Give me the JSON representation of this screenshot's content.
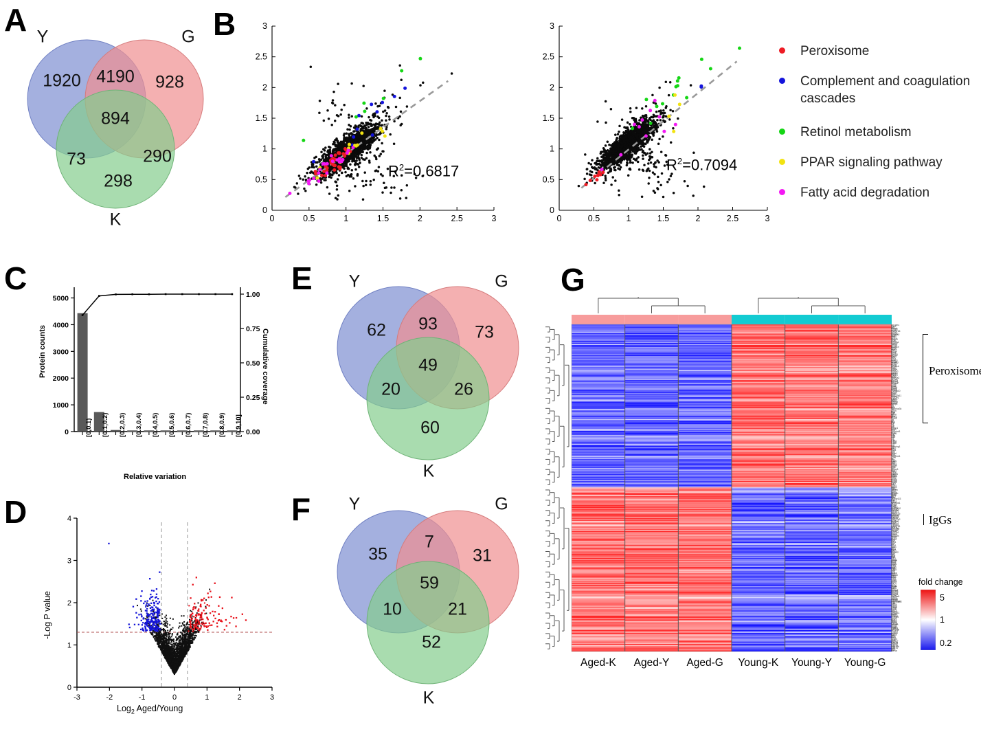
{
  "figure": {
    "panels": [
      "A",
      "B",
      "C",
      "D",
      "E",
      "F",
      "G"
    ]
  },
  "panelA": {
    "letter": "A",
    "labels": {
      "y": "Y",
      "g": "G",
      "k": "K"
    },
    "counts": {
      "y_only": "1920",
      "g_only": "928",
      "k_only": "298",
      "yg": "4190",
      "yk": "73",
      "gk": "290",
      "ygk": "894"
    },
    "colors": {
      "y": "#8b9ad6",
      "g": "#ef8f90",
      "k": "#85cd8d"
    }
  },
  "panelB": {
    "letter": "B",
    "scatter_left": {
      "r2_label": "R",
      "r2_exp": "2",
      "r2_value": "=0.6817",
      "xticks": [
        "0",
        "0.5",
        "1",
        "1.5",
        "2",
        "2.5",
        "3"
      ],
      "yticks": [
        "0",
        "0.5",
        "1",
        "1.5",
        "2",
        "2.5",
        "3"
      ],
      "xlim": [
        0,
        3
      ],
      "ylim": [
        0,
        3
      ]
    },
    "scatter_right": {
      "r2_label": "R",
      "r2_exp": "2",
      "r2_value": "=0.7094",
      "xticks": [
        "0",
        "0.5",
        "1",
        "1.5",
        "2",
        "2.5",
        "3"
      ],
      "yticks": [
        "0",
        "0.5",
        "1",
        "1.5",
        "2",
        "2.5",
        "3"
      ],
      "xlim": [
        0,
        3
      ],
      "ylim": [
        0,
        3
      ]
    },
    "legend": [
      {
        "label": "Peroxisome",
        "color": "#ee1c25"
      },
      {
        "label": "Complement and coagulation cascades",
        "color": "#1414dc"
      },
      {
        "label": "Retinol metabolism",
        "color": "#15d615"
      },
      {
        "label": "PPAR signaling pathway",
        "color": "#f2e311"
      },
      {
        "label": "Fatty acid degradation",
        "color": "#f318f3"
      }
    ]
  },
  "panelC": {
    "letter": "C",
    "chart_data": {
      "type": "bar",
      "title": "",
      "xlabel": "Relative variation",
      "ylabel": "Protein counts",
      "y2label": "Cumulative coverage",
      "categories": [
        "[0,0.1)",
        "[0.1,0.2)",
        "[0.2,0.3)",
        "[0.3,0.4)",
        "[0.4,0.5)",
        "[0.5,0.6)",
        "[0.6,0.7)",
        "[0.7,0.8)",
        "[0.8,0.9)",
        "[0.9,10]"
      ],
      "values": [
        4430,
        730,
        60,
        5,
        3,
        2,
        2,
        1,
        1,
        1
      ],
      "cumulative": [
        0.847,
        0.987,
        0.998,
        0.999,
        0.999,
        1.0,
        1.0,
        1.0,
        1.0,
        1.0
      ],
      "yticks": [
        "0",
        "1000",
        "2000",
        "3000",
        "4000",
        "5000"
      ],
      "ylim": [
        0,
        5400
      ],
      "y2ticks": [
        "0.00",
        "0.25",
        "0.50",
        "0.75",
        "1.00"
      ],
      "y2lim": [
        0,
        1.05
      ],
      "bar_color": "#595959",
      "line_color": "#000000",
      "grid": false
    }
  },
  "panelD": {
    "letter": "D",
    "chart_data": {
      "type": "scatter",
      "title": "",
      "xlabel_pre": "Log",
      "xlabel_sub": "2",
      "xlabel_post": " Aged/Young",
      "ylabel": "-Log P value",
      "xticks": [
        "-3",
        "-2",
        "-1",
        "0",
        "1",
        "2",
        "3"
      ],
      "yticks": [
        "0",
        "1",
        "2",
        "3",
        "4"
      ],
      "xlim": [
        -3,
        3
      ],
      "ylim": [
        0,
        4
      ],
      "threshold_x": [
        -0.4,
        0.4
      ],
      "threshold_y": 1.3,
      "up_color": "#e8111a",
      "down_color": "#1515d8",
      "ns_color": "#101010"
    }
  },
  "panelE": {
    "letter": "E",
    "labels": {
      "y": "Y",
      "g": "G",
      "k": "K"
    },
    "counts": {
      "y_only": "62",
      "g_only": "73",
      "k_only": "60",
      "yg": "93",
      "yk": "20",
      "gk": "26",
      "ygk": "49"
    }
  },
  "panelF": {
    "letter": "F",
    "labels": {
      "y": "Y",
      "g": "G",
      "k": "K"
    },
    "counts": {
      "y_only": "35",
      "g_only": "31",
      "k_only": "52",
      "yg": "7",
      "yk": "10",
      "gk": "21",
      "ygk": "59"
    }
  },
  "panelG": {
    "letter": "G",
    "columns": [
      "Aged-K",
      "Aged-Y",
      "Aged-G",
      "Young-K",
      "Young-Y",
      "Young-G"
    ],
    "group_colors": {
      "aged": "#f79c9c",
      "young": "#13cbd2"
    },
    "annotations": [
      {
        "label": "Peroxisome",
        "y": 540
      },
      {
        "label": "IgGs",
        "y": 757
      }
    ],
    "colorbar": {
      "title": "fold change",
      "top": "5",
      "mid": "1",
      "bottom": "0.2",
      "high_color": "#ee1111",
      "mid_color": "#ffffff",
      "low_color": "#1919ee"
    },
    "row_labels_top": [
      "Slc35b1",
      "Pex1",
      "Cat",
      "Mlycd",
      "Pex19",
      "Acot1",
      "Hsd17b4",
      "Acox2",
      "Pex16",
      "Aldh3a2",
      "Nudt7",
      "Idh1",
      "Acsl1",
      "Abcd3",
      "Crat",
      "Sod1",
      "Pex11a",
      "Ephx2",
      "Gstk1",
      "Acot8",
      "Acaa1b",
      "Pex2",
      "Acot2",
      "Mvk",
      "Decr2",
      "Pex5",
      "Ech1",
      "Pex13",
      "Acox3",
      "Hacl1",
      "Idh2",
      "Pecr",
      "Cryl1",
      "Pex12",
      "Abcd1",
      "Nudt12",
      "Acsl4",
      "Pex6",
      "Acaa1a",
      "Scp2",
      "Paox",
      "Gnpat",
      "Far1",
      "Pxmp2",
      "Agps",
      "Amacr",
      "Pex14",
      "Cat2",
      "Nos2",
      "Slc27a2",
      "Dhrs4",
      "Mpv17",
      "Acnat1",
      "Pex11b",
      "Hmgcl",
      "Sod2",
      "Cpt2",
      "Echs1",
      "Pipox",
      "Acadl",
      "Prdx5",
      "Cyp4a10",
      "Acot3",
      "Decr1",
      "Eci2",
      "Hsd17b11",
      "Acaa2",
      "Cyp2e1",
      "Ephx1",
      "Adh1",
      "Aldh2",
      "Ces1d",
      "Apoa1",
      "Fabp1",
      "Gc",
      "Alb",
      "Hpx",
      "Serpina3k",
      "Ttr",
      "Apoh",
      "Fga",
      "Fgb",
      "Ahsg",
      "Hp",
      "Itih4",
      "Ambp",
      "Orm1",
      "Trf",
      "Cp",
      "Hrg",
      "Plg",
      "F2",
      "C3",
      "Cfb",
      "C9",
      "Masp1",
      "Kng1",
      "Vtn",
      "Serpind1",
      "Proc",
      "Pros1",
      "Cfh",
      "C8a",
      "C8b",
      "C6",
      "C5",
      "C4b",
      "C1qa",
      "C1qb",
      "C1qc",
      "C2",
      "Cfd",
      "Serping1",
      "Cfi",
      "Mbl2",
      "Fcn1",
      "Clu",
      "Vwf",
      "Thbd",
      "Plat",
      "Plau",
      "Serpine1",
      "A2m",
      "Il6",
      "Crp",
      "Saa1",
      "Saa2",
      "Lbp",
      "Cd14",
      "Hamp",
      "Lcn2",
      "Fth1",
      "Ftl1",
      "Hmox1",
      "Nqo1",
      "Gclc",
      "Gsta1",
      "Gstm1",
      "Gstp1",
      "Mgst1",
      "Gpx1",
      "Txn1",
      "Prdx1",
      "Prdx2",
      "Prdx6",
      "Sod3",
      "Cat3",
      "Gsr",
      "Gpx4",
      "Srxn1"
    ],
    "row_labels_bottom": [
      "Igkc",
      "Ighm",
      "Jchain",
      "Igha",
      "Ighg1",
      "Ighg2b",
      "Ighg3",
      "Iglc1",
      "Iglc2",
      "Igkv",
      "Dnase1l3",
      "Cfp",
      "Cfhr1",
      "Apcs",
      "Serpina1",
      "Mug1",
      "Mup3",
      "Car3",
      "Acsm1",
      "Slc25a20",
      "Ugt1a1",
      "Slc22a7",
      "Abcb11",
      "Adh4",
      "Cyp2c29",
      "Aldh1a1",
      "Ugt2b5",
      "Cyp1a2",
      "Ces3a",
      "Hsd17b2",
      "Acot12",
      "Sult1a1",
      "Baat",
      "Cyp7b1",
      "Cyp8b1",
      "Cyp27a1",
      "Nr1h4",
      "Slc10a1",
      "Slco1b2",
      "Akr1c6",
      "Gsta3",
      "Sult2a1",
      "Fmo1",
      "Fmo3",
      "Ephx2b",
      "Nnmt",
      "Gnmt",
      "Bhmt",
      "Cbs",
      "Cth",
      "Got1",
      "Gpt",
      "Asl",
      "Ass1",
      "Cps1",
      "Otc",
      "Arg1",
      "Agxt",
      "Hao1",
      "Prodh2",
      "Sds",
      "Tat",
      "Hpd",
      "Hgd",
      "Fah",
      "Gls2",
      "Glud1",
      "Aldob",
      "Fbp1",
      "Pck1",
      "G6pc",
      "Gys2",
      "Pygl",
      "Ugp2",
      "Gale",
      "Galk1",
      "Galt",
      "Khk",
      "Aldoa",
      "Tpi1",
      "Gapdh",
      "Pgk1",
      "Eno1",
      "Pkm",
      "Ldha",
      "Ldhb",
      "Mdh1",
      "Mdh2",
      "Cs",
      "Aco2",
      "Idh3a",
      "Ogdh",
      "Sdha",
      "Fh1",
      "Sucla2",
      "Atp5a1",
      "Ndufs1",
      "Uqcrc1",
      "Cox4i1",
      "Cycs",
      "Slc25a5",
      "Vdac1",
      "Hspa5",
      "Hspa8",
      "Hsp90aa1",
      "Hsp90ab1",
      "Calr",
      "Canx",
      "Pdia3",
      "Pdia4",
      "Pdia6",
      "P4hb",
      "Ero1l",
      "Sel1l",
      "Hyou1",
      "Dnajb11",
      "Sdf2l1",
      "Manf",
      "Creld2",
      "Txndc5",
      "Serp1",
      "Rpn1",
      "Rpn2",
      "Ddost",
      "Stt3a",
      "Ganab",
      "Prkcsh",
      "Mogs",
      "Uggt1",
      "Lman1",
      "Sec23a",
      "Sec24c",
      "Copb1",
      "Copg1",
      "Arcn1",
      "Napa",
      "Nsf",
      "Stx5",
      "Bet1",
      "Gosr2",
      "Ykt6",
      "Vamp7",
      "Rab1a",
      "Rab2a",
      "Rab5c",
      "Rab7a",
      "Rab11b",
      "Rab14",
      "Arf1",
      "Arf4",
      "Sar1a"
    ]
  }
}
